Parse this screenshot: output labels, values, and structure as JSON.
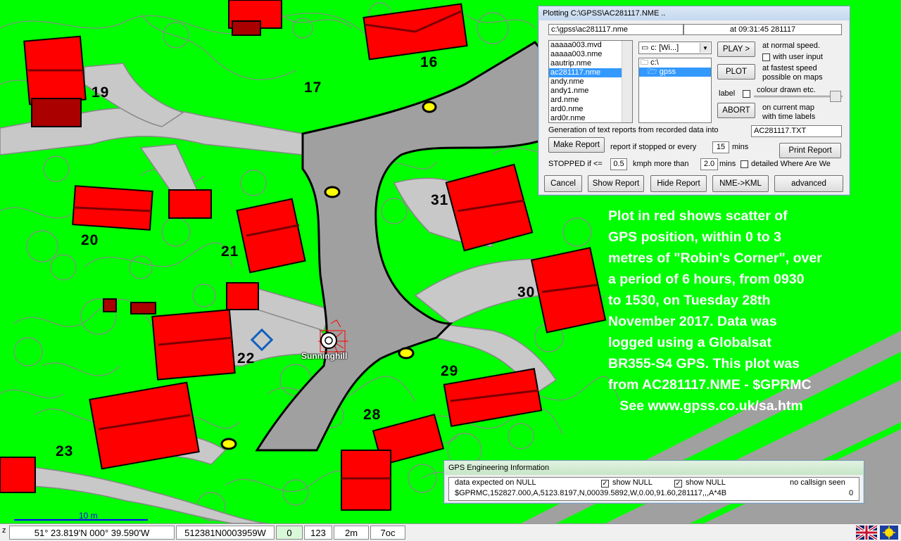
{
  "map": {
    "house_numbers": [
      "16",
      "17",
      "19",
      "20",
      "21",
      "22",
      "23",
      "28",
      "29",
      "30",
      "31"
    ],
    "waypoint_label": "Sunninghill",
    "scale_label": "10 m",
    "colors": {
      "grass": "#00ff00",
      "road": "#a0a0a0",
      "path": "#c8c8c8",
      "roof": "#ff0000",
      "roof_dark": "#7a0000",
      "contour": "#888888"
    }
  },
  "plot_dialog": {
    "title": "Plotting C:\\GPSS\\AC281117.NME ..",
    "file_path": "c:\\gpss\\ac281117.nme",
    "time_info": "at 09:31:45 281117",
    "files": [
      "aaaaa003.mvd",
      "aaaaa003.nme",
      "aautrip.nme",
      "ac281117.nme",
      "andy.nme",
      "andy1.nme",
      "ard.nme",
      "ard0.nme",
      "ard0r.nme"
    ],
    "selected_file": "ac281117.nme",
    "drive": "c: [Wi...]",
    "folders": [
      "c:\\",
      "gpss"
    ],
    "selected_folder": "gpss",
    "play_label": "PLAY >",
    "play_desc": "at normal speed.",
    "user_input_label": "with user input",
    "plot_label": "PLOT",
    "plot_desc_1": "at fastest speed",
    "plot_desc_2": "possible on maps",
    "label_label": "label",
    "colour_label": "colour drawn etc.",
    "abort_label": "ABORT",
    "abort_desc_1": "on current map",
    "abort_desc_2": "with time labels",
    "generation_label": "Generation of text reports from recorded data into",
    "report_file": "AC281117.TXT",
    "make_report": "Make Report",
    "report_every_label": "report if stopped or every",
    "report_every_value": "15",
    "mins_label": "mins",
    "print_report": "Print Report",
    "stopped_label": "STOPPED if <=",
    "stopped_value": "0.5",
    "kmph_label": "kmph more than",
    "more_than_value": "2.0",
    "mins_label_2": "mins",
    "detailed_label": "detailed Where Are We",
    "cancel": "Cancel",
    "show_report": "Show Report",
    "hide_report": "Hide Report",
    "nme_kml": "NME->KML",
    "advanced": "advanced"
  },
  "overlay_text": [
    "Plot in red shows scatter of",
    "GPS position, within 0 to 3",
    "metres of \"Robin's Corner\", over",
    "a period of 6 hours, from 0930",
    "to 1530, on Tuesday 28th",
    "November 2017. Data was",
    "logged using a Globalsat",
    "BR355-S4 GPS. This plot was",
    "from AC281117.NME - $GPRMC",
    "   See www.gpss.co.uk/sa.htm"
  ],
  "gps_engineering": {
    "title": "GPS Engineering Information",
    "data_expected": "data expected on NULL",
    "show_null_1": "show NULL",
    "show_null_2": "show NULL",
    "callsign": "no callsign seen",
    "sentence": "$GPRMC,152827.000,A,5123.8197,N,00039.5892,W,0.00,91.60,281117,,,A*4B",
    "count": "0"
  },
  "statusbar": {
    "z_label": "z",
    "coords": "51° 23.819'N 000° 39.590'W",
    "grid_ref": "512381N0003959W",
    "value_0": "0",
    "value_123": "123",
    "scale": "2m",
    "code": "7oc"
  }
}
